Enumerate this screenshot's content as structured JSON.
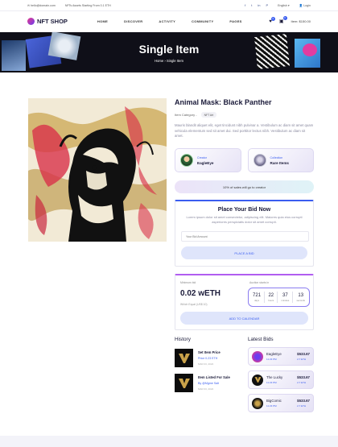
{
  "topbar": {
    "email": "hello@domain.com",
    "promo": "NFTs Assets Starting From 0.1 ETH",
    "language": "English",
    "login": "Login",
    "socials": [
      "f",
      "t",
      "in",
      "P"
    ]
  },
  "nav": {
    "logo": "NFT SHOP",
    "items": [
      "HOME",
      "DISCOVER",
      "ACTIVITY",
      "COMMUNITY",
      "PAGES"
    ],
    "cart_count": "0",
    "bag_count": "0",
    "total": "Item: $150.00"
  },
  "hero": {
    "title": "Single Item",
    "crumb_home": "Home",
    "crumb_sep": "›",
    "crumb_current": "Single Item"
  },
  "item": {
    "name": "Animal Mask: Black Panther",
    "category_label": "Item Category -",
    "category": "NFT Art",
    "description": "Mauris blandit aliquet elit, eget tincidunt nibh pulvinar a. Vestibulum ac diam sit amet quam vehicula elementum sed sit amet dui. Sed porttitor lectus nibh. Vestibulum ac diam sit amet."
  },
  "creator": {
    "label": "Creator",
    "name": "EagleEye"
  },
  "collection": {
    "label": "Collection",
    "name": "Rare Items"
  },
  "royalty": "10% of sales will go to creator",
  "bid": {
    "title": "Place Your Bid Now",
    "text": "Lorem ipsum dolor sit amet consectetur, adipiscing elit. Maiores quia eius corrupti asperiores perspiciatis dolor sit amet corrupti.",
    "placeholder": "Your Bid Amount",
    "button": "PLACE A BID"
  },
  "auction": {
    "min_label": "Minimum bid",
    "amount": "0.02 wETH",
    "equal": "Which Equal (US$ 10)",
    "ends_label": "Auction starts in",
    "countdown": [
      {
        "value": "721",
        "unit": "days"
      },
      {
        "value": "22",
        "unit": "hours"
      },
      {
        "value": "37",
        "unit": "minutes"
      },
      {
        "value": "13",
        "unit": "seconds"
      }
    ],
    "calendar_button": "ADD TO CALENDAR"
  },
  "history": {
    "title": "History",
    "items": [
      {
        "title": "Set Item Price",
        "sub": "Price 0.23 ETH",
        "date": "MAR 03, 2022"
      },
      {
        "title": "Item Listed For Sale",
        "sub": "By @Mgme Salt",
        "date": "MAR 03, 2022"
      }
    ]
  },
  "latest": {
    "title": "Latest Bids",
    "items": [
      {
        "name": "EagleEye",
        "time": "11:23 PM",
        "price": "$533.67",
        "eth": "2.7 ETH"
      },
      {
        "name": "The Lucky",
        "time": "11:23 PM",
        "price": "$533.67",
        "eth": "2.7 ETH"
      },
      {
        "name": "BigComic",
        "time": "11:23 PM",
        "price": "$533.67",
        "eth": "2.7 ETH"
      }
    ]
  },
  "colors": {
    "accent": "#3a5df0",
    "purple": "#8a7cf0",
    "dark": "#1b1b3a",
    "gold": "#c9a24a"
  }
}
